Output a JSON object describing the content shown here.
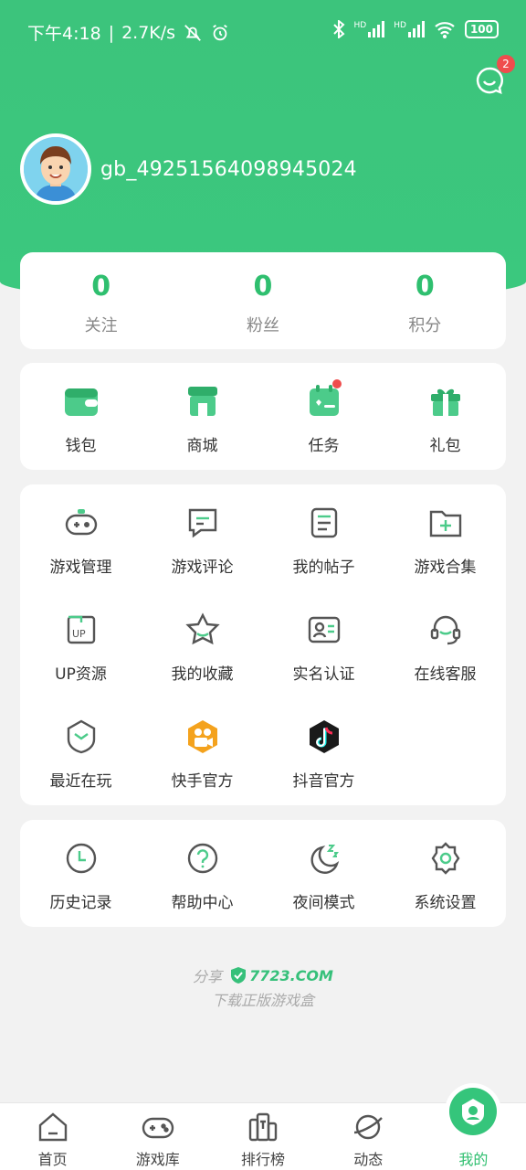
{
  "status_bar": {
    "time": "下午4:18",
    "speed": "2.7K/s",
    "battery": "100",
    "signal_label": "HD"
  },
  "header": {
    "message_badge": "2",
    "username": "gb_49251564098945024"
  },
  "stats": [
    {
      "value": "0",
      "label": "关注"
    },
    {
      "value": "0",
      "label": "粉丝"
    },
    {
      "value": "0",
      "label": "积分"
    }
  ],
  "quick_actions": [
    {
      "label": "钱包",
      "icon": "wallet-icon"
    },
    {
      "label": "商城",
      "icon": "shop-icon"
    },
    {
      "label": "任务",
      "icon": "task-icon"
    },
    {
      "label": "礼包",
      "icon": "gift-icon"
    }
  ],
  "services": [
    {
      "label": "游戏管理",
      "icon": "gamepad-icon"
    },
    {
      "label": "游戏评论",
      "icon": "comment-icon"
    },
    {
      "label": "我的帖子",
      "icon": "post-icon"
    },
    {
      "label": "游戏合集",
      "icon": "folder-plus-icon"
    },
    {
      "label": "UP资源",
      "icon": "up-icon"
    },
    {
      "label": "我的收藏",
      "icon": "star-icon"
    },
    {
      "label": "实名认证",
      "icon": "id-card-icon"
    },
    {
      "label": "在线客服",
      "icon": "headset-icon"
    },
    {
      "label": "最近在玩",
      "icon": "recent-play-icon"
    },
    {
      "label": "快手官方",
      "icon": "kuaishou-icon"
    },
    {
      "label": "抖音官方",
      "icon": "douyin-icon"
    }
  ],
  "misc": [
    {
      "label": "历史记录",
      "icon": "clock-icon"
    },
    {
      "label": "帮助中心",
      "icon": "help-icon"
    },
    {
      "label": "夜间模式",
      "icon": "moon-icon"
    },
    {
      "label": "系统设置",
      "icon": "gear-icon"
    }
  ],
  "share": {
    "prefix": "分享",
    "brand": "7723.COM",
    "tagline": "下载正版游戏盒"
  },
  "bottom_nav": [
    {
      "label": "首页",
      "icon": "home-icon"
    },
    {
      "label": "游戏库",
      "icon": "game-library-icon"
    },
    {
      "label": "排行榜",
      "icon": "ranking-icon"
    },
    {
      "label": "动态",
      "icon": "planet-icon"
    },
    {
      "label": "我的",
      "icon": "mine-icon",
      "active": true
    }
  ],
  "colors": {
    "brand_green": "#3bc47c",
    "badge_red": "#ef4d4d",
    "stat_green": "#2fbf6f"
  }
}
